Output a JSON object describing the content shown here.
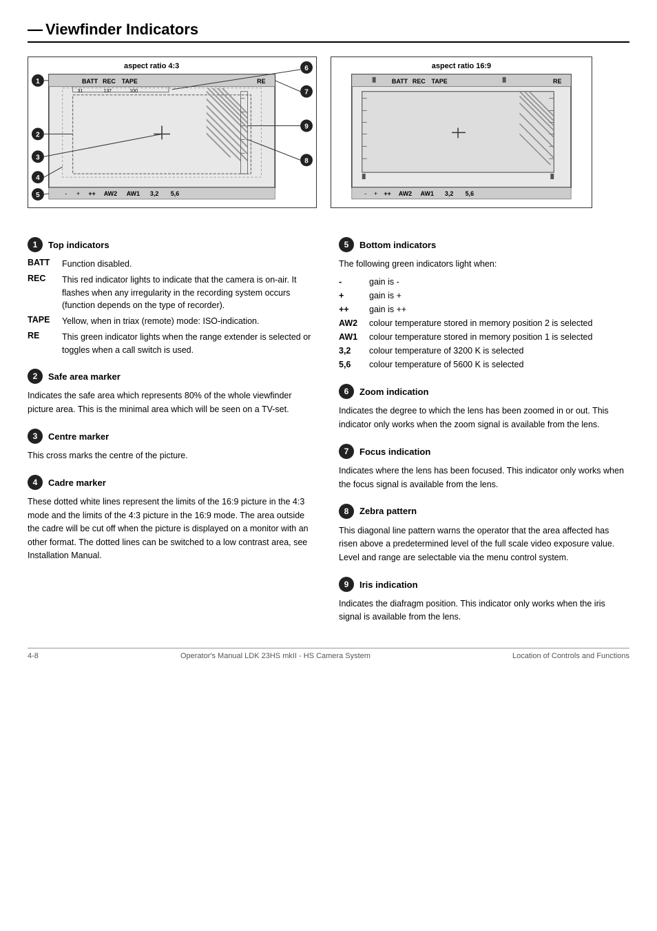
{
  "page": {
    "title": "Viewfinder Indicators",
    "footer_left": "4-8",
    "footer_center": "Operator's Manual LDK 23HS mkII - HS Camera System",
    "footer_right": "Location of Controls and Functions"
  },
  "diagrams": {
    "left_label": "aspect ratio 4:3",
    "right_label": "aspect ratio 16:9"
  },
  "sections": {
    "s1": {
      "num": "1",
      "heading": "Top indicators",
      "items": [
        {
          "key": "BATT",
          "val": "Function disabled."
        },
        {
          "key": "REC",
          "val": "This red indicator lights to indicate that the camera is on-air.      It flashes when any irregularity in the recording system occurs (function depends on the type of recorder)."
        },
        {
          "key": "TAPE",
          "val": "Yellow, when in triax (remote) mode: ISO-indication."
        },
        {
          "key": "RE",
          "val": "This green indicator lights when the range extender is selected or toggles when a call switch is used."
        }
      ]
    },
    "s2": {
      "num": "2",
      "heading": "Safe area marker",
      "body": "Indicates the safe area which represents 80% of the whole viewfinder picture area. This is the minimal area which will be seen on a TV-set."
    },
    "s3": {
      "num": "3",
      "heading": "Centre marker",
      "body": "This cross marks the centre of the picture."
    },
    "s4": {
      "num": "4",
      "heading": "Cadre marker",
      "body": "These dotted white lines represent the limits of the 16:9 picture in the 4:3 mode and the limits of the 4:3 picture in the 16:9 mode. The area outside the cadre will be cut off when the picture is displayed on a monitor with an other format. The dotted lines can be switched to a low contrast area, see Installation Manual."
    },
    "s5": {
      "num": "5",
      "heading": "Bottom indicators",
      "intro": "The following green indicators light when:",
      "items": [
        {
          "key": "-",
          "val": "gain is -"
        },
        {
          "key": "+",
          "val": "gain is +"
        },
        {
          "key": "++",
          "val": "gain is ++"
        },
        {
          "key": "AW2",
          "val": "colour temperature stored in memory position 2 is selected"
        },
        {
          "key": "AW1",
          "val": "colour temperature stored in memory position 1 is selected"
        },
        {
          "key": "3,2",
          "val": "colour temperature  of 3200 K is selected"
        },
        {
          "key": "5,6",
          "val": "colour temperature  of 5600 K is selected"
        }
      ]
    },
    "s6": {
      "num": "6",
      "heading": "Zoom indication",
      "body": "Indicates the degree to which the lens has been zoomed in or out. This indicator only works when the zoom signal is available from the lens."
    },
    "s7": {
      "num": "7",
      "heading": "Focus indication",
      "body": "Indicates where the lens has been focused. This indicator only works when the focus signal is available from the lens."
    },
    "s8": {
      "num": "8",
      "heading": "Zebra pattern",
      "body": "This diagonal line pattern warns the operator that the area affected has risen above a predetermined level of the full scale video exposure value. Level and range are selectable via the menu control system."
    },
    "s9": {
      "num": "9",
      "heading": "Iris indication",
      "body": "Indicates the diafragm position. This indicator only works when the iris signal is available from the lens."
    }
  }
}
